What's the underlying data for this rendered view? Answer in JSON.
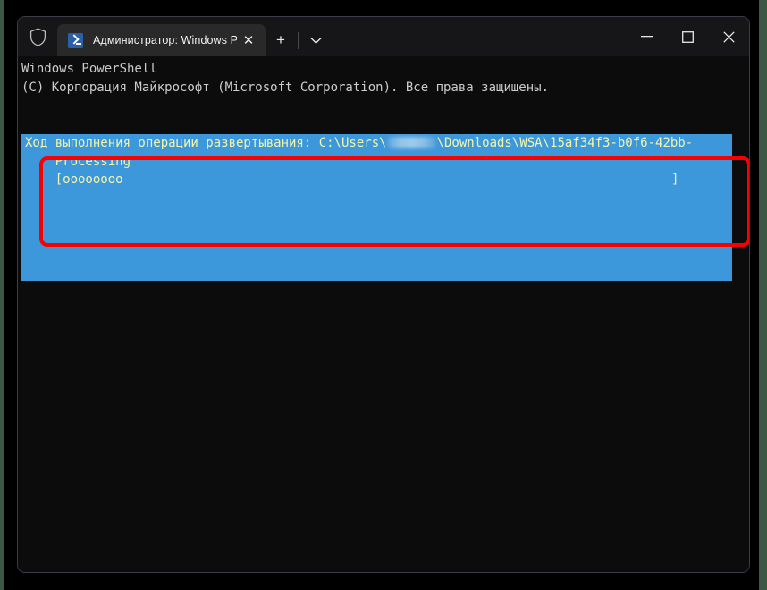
{
  "window": {
    "titlebar": {
      "shield_icon": "shield-icon",
      "tab": {
        "icon": "powershell-icon",
        "title": "Администратор: Windows Pc",
        "close_label": "✕"
      },
      "new_tab_label": "+",
      "dropdown_icon": "chevron-down-icon",
      "minimize_label": "—",
      "maximize_label": "☐",
      "close_label": "✕"
    }
  },
  "console": {
    "header_lines": [
      "Windows PowerShell",
      "(C) Корпорация Майкрософт (Microsoft Corporation). Все права защищены."
    ],
    "progress": {
      "line1_prefix": "Ход выполнения операции развертывания: C:\\Users\\",
      "line1_redacted": "redacted-username",
      "line1_suffix": "\\Downloads\\WSA\\15af34f3-b0f6-42bb-",
      "line2": "    Processing",
      "line3_bar": "    [oooooooo",
      "line3_close": "]",
      "blank_line": " "
    }
  },
  "annotation": {
    "highlight_box": "red-rectangle-highlight"
  },
  "colors": {
    "console_background": "#0c0c0c",
    "titlebar_background": "#161618",
    "tab_background": "#292929",
    "progress_background": "#3d97db",
    "progress_text": "#f5f5a8",
    "console_text": "#cccccc",
    "annotation_red": "#f90000",
    "desktop_edge": "#3d5743",
    "powershell_icon_blue": "#2b5fa8"
  }
}
